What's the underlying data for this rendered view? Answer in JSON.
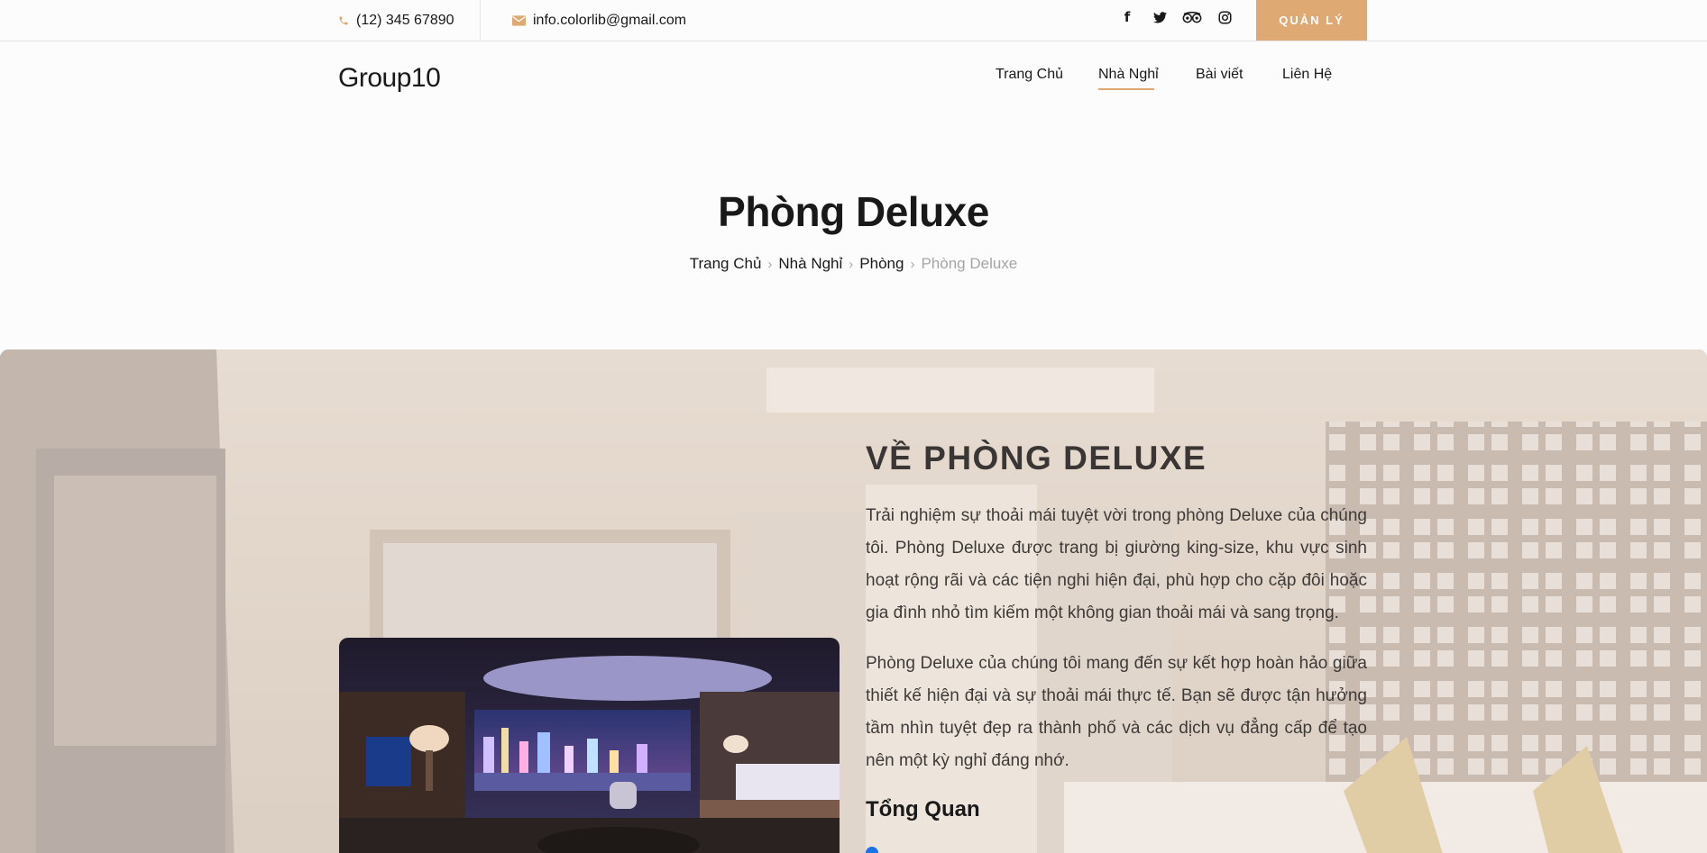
{
  "topbar": {
    "phone": "(12) 345 67890",
    "email": "info.colorlib@gmail.com",
    "socials": [
      {
        "icon": "facebook-icon",
        "glyph": "f"
      },
      {
        "icon": "twitter-icon",
        "glyph": "t"
      },
      {
        "icon": "tripadvisor-icon",
        "glyph": "oo"
      },
      {
        "icon": "instagram-icon",
        "glyph": "◎"
      }
    ],
    "manage_label": "QUẢN LÝ"
  },
  "header": {
    "logo": "Group10",
    "nav": [
      {
        "label": "Trang Chủ",
        "active": false
      },
      {
        "label": "Nhà Nghỉ",
        "active": true
      },
      {
        "label": "Bài viết",
        "active": false
      },
      {
        "label": "Liên Hệ",
        "active": false
      }
    ]
  },
  "hero": {
    "title": "Phòng Deluxe",
    "breadcrumb": [
      "Trang Chủ",
      "Nhà Nghỉ",
      "Phòng"
    ],
    "breadcrumb_current": "Phòng Deluxe"
  },
  "about": {
    "title": "VỀ PHÒNG DELUXE",
    "paragraph1": "Trải nghiệm sự thoải mái tuyệt vời trong phòng Deluxe của chúng tôi. Phòng Deluxe được trang bị giường king-size, khu vực sinh hoạt rộng rãi và các tiện nghi hiện đại, phù hợp cho cặp đôi hoặc gia đình nhỏ tìm kiếm một không gian thoải mái và sang trọng.",
    "paragraph2": "Phòng Deluxe của chúng tôi mang đến sự kết hợp hoàn hảo giữa thiết kế hiện đại và sự thoải mái thực tế. Bạn sẽ được tận hưởng tầm nhìn tuyệt đẹp ra thành phố và các dịch vụ đẳng cấp để tạo nên một kỳ nghỉ đáng nhớ.",
    "overview_title": "Tổng Quan"
  },
  "colors": {
    "accent": "#dfa974",
    "text": "#19191a",
    "muted": "#a5a5a5"
  }
}
